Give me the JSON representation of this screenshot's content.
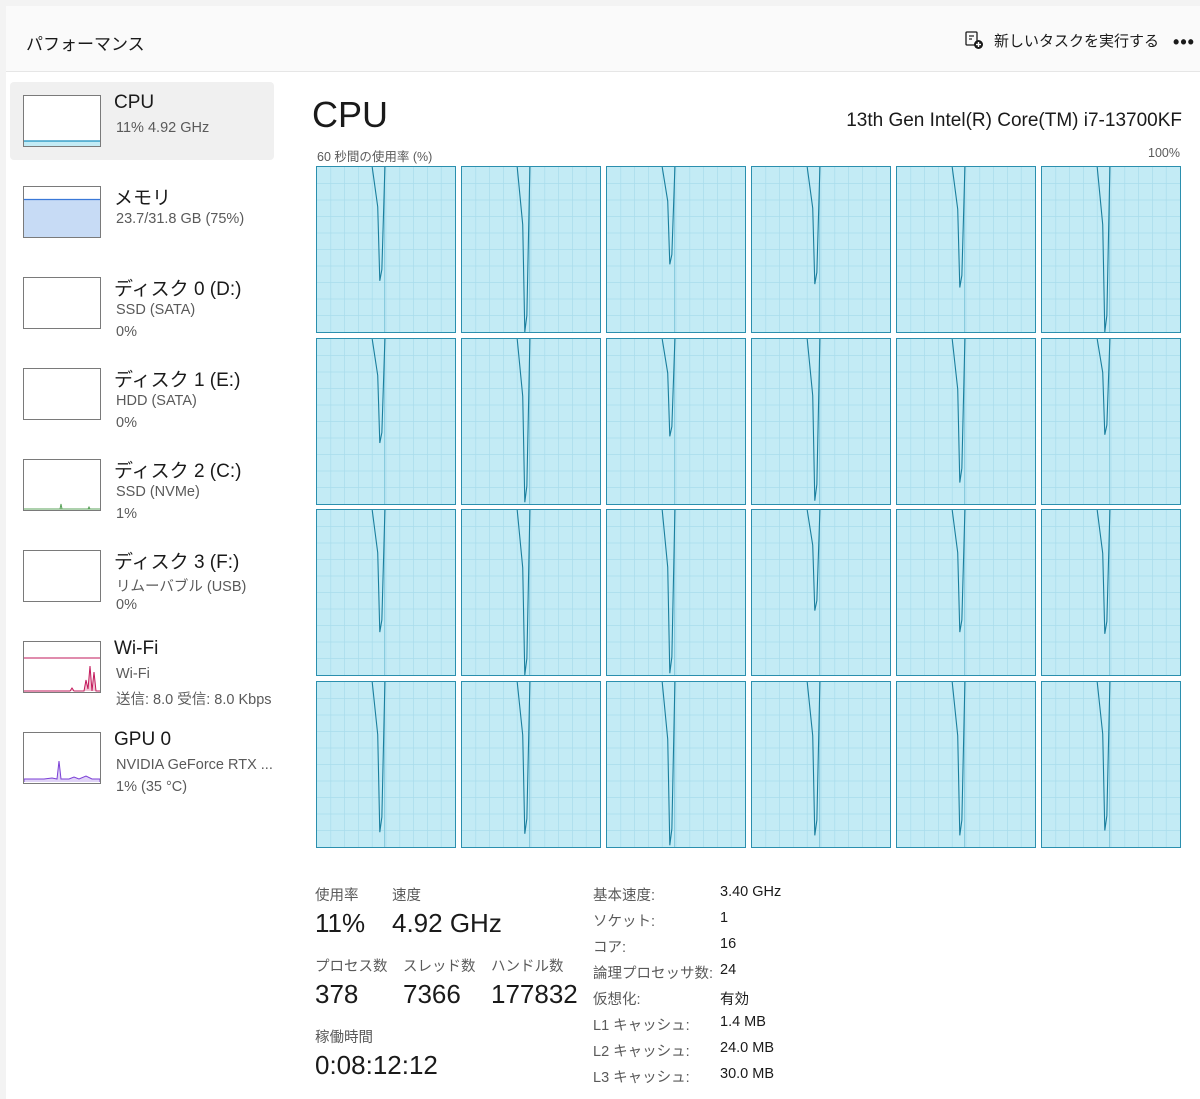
{
  "header": {
    "title": "パフォーマンス",
    "run_task_label": "新しいタスクを実行する",
    "run_task_icon": "new-task-icon",
    "more_label": "•••"
  },
  "sidebar": {
    "items": [
      {
        "name": "CPU",
        "line1": "11%  4.92 GHz",
        "line2": "",
        "icon": "cpu-graph",
        "accent": "#1a8fbf",
        "usage_percent": 11
      },
      {
        "name": "メモリ",
        "line1": "23.7/31.8 GB (75%)",
        "line2": "",
        "icon": "memory-graph",
        "accent": "#3a78d8",
        "usage_percent": 75
      },
      {
        "name": "ディスク 0 (D:)",
        "line1": "SSD (SATA)",
        "line2": "0%",
        "icon": "disk-graph",
        "accent": "#5ba35b",
        "usage_percent": 0
      },
      {
        "name": "ディスク 1 (E:)",
        "line1": "HDD (SATA)",
        "line2": "0%",
        "icon": "disk-graph",
        "accent": "#5ba35b",
        "usage_percent": 0
      },
      {
        "name": "ディスク 2 (C:)",
        "line1": "SSD (NVMe)",
        "line2": "1%",
        "icon": "disk-graph",
        "accent": "#5ba35b",
        "usage_percent": 1
      },
      {
        "name": "ディスク 3 (F:)",
        "line1": "リムーバブル (USB)",
        "line2": "0%",
        "icon": "disk-graph",
        "accent": "#5ba35b",
        "usage_percent": 0
      },
      {
        "name": "Wi-Fi",
        "line1": "Wi-Fi",
        "line2": "送信: 8.0  受信: 8.0 Kbps",
        "icon": "network-graph",
        "accent": "#c2185b",
        "usage_percent": 2
      },
      {
        "name": "GPU 0",
        "line1": "NVIDIA GeForce RTX ...",
        "line2": "1% (35 °C)",
        "icon": "gpu-graph",
        "accent": "#7b3fd6",
        "usage_percent": 1
      }
    ]
  },
  "main": {
    "title": "CPU",
    "cpu_model": "13th Gen Intel(R) Core(TM) i7-13700KF",
    "axis_label": "60 秒間の使用率 (%)",
    "axis_max": "100%",
    "colors": {
      "core_fill": "#c3ebf5",
      "core_line": "#1a7f9e",
      "core_border": "#2b8fae"
    }
  },
  "stats": {
    "usage_label": "使用率",
    "usage_value": "11%",
    "speed_label": "速度",
    "speed_value": "4.92 GHz",
    "processes_label": "プロセス数",
    "processes_value": "378",
    "threads_label": "スレッド数",
    "threads_value": "7366",
    "handles_label": "ハンドル数",
    "handles_value": "177832",
    "uptime_label": "稼働時間",
    "uptime_value": "0:08:12:12"
  },
  "specs": [
    {
      "key": "基本速度:",
      "value": "3.40 GHz"
    },
    {
      "key": "ソケット:",
      "value": "1"
    },
    {
      "key": "コア:",
      "value": "16"
    },
    {
      "key": "論理プロセッサ数:",
      "value": "24"
    },
    {
      "key": "仮想化:",
      "value": "有効"
    },
    {
      "key": "L1 キャッシュ:",
      "value": "1.4 MB"
    },
    {
      "key": "L2 キャッシュ:",
      "value": "24.0 MB"
    },
    {
      "key": "L3 キャッシュ:",
      "value": "30.0 MB"
    }
  ],
  "chart_data": {
    "type": "line",
    "title": "60 秒間の使用率 (%)",
    "ylim": [
      0,
      100
    ],
    "series_count": 24,
    "note_values": "per-core utilization estimated: ~100% except a single dip",
    "dip_min_percent": [
      31,
      0,
      41,
      29,
      27,
      0,
      37,
      1,
      41,
      2,
      13,
      42,
      26,
      0,
      1,
      39,
      26,
      25,
      9,
      8,
      1,
      7,
      7,
      10
    ]
  }
}
